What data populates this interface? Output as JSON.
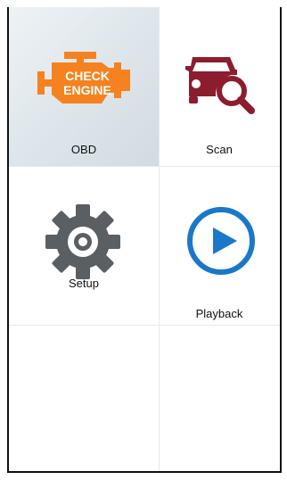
{
  "menu": {
    "items": [
      {
        "label": "OBD",
        "icon": "check-engine-icon",
        "selected": true
      },
      {
        "label": "Scan",
        "icon": "car-search-icon",
        "selected": false
      },
      {
        "label": "Setup",
        "icon": "gear-icon",
        "selected": false
      },
      {
        "label": "Playback",
        "icon": "play-icon",
        "selected": false
      }
    ],
    "obd_icon_text": [
      "CHECK",
      "ENGINE"
    ]
  },
  "colors": {
    "engine_orange": "#f5821f",
    "scan_red": "#8c1d2f",
    "gear_gray": "#5a5f64",
    "play_blue": "#1a78c9",
    "selected_bg": "#dde5ea"
  }
}
